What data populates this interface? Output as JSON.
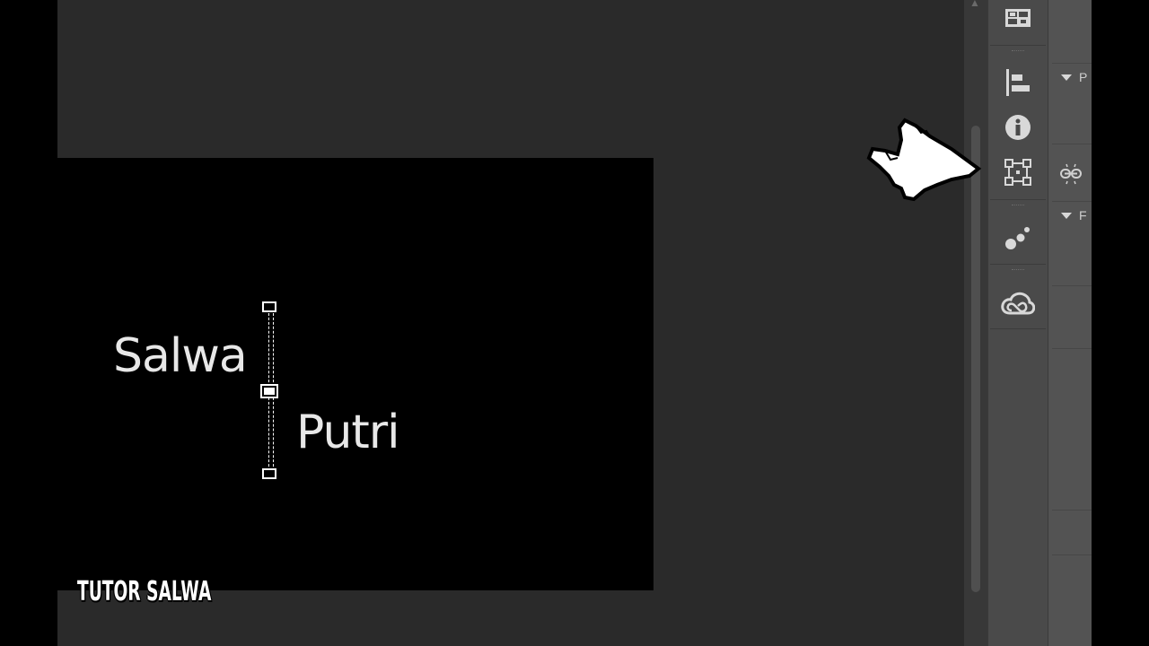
{
  "canvas": {
    "text_line_1": "Salwa",
    "text_line_2": "Putri"
  },
  "toolbar": {
    "items": [
      {
        "name": "libraries-icon"
      },
      {
        "name": "align-icon"
      },
      {
        "name": "info-icon"
      },
      {
        "name": "transform-icon"
      },
      {
        "name": "cc-libraries-dots-icon"
      },
      {
        "name": "creative-cloud-icon"
      }
    ]
  },
  "panel": {
    "section_1_label": "P",
    "section_2_label": "F"
  },
  "watermark": "TUTOR SALWA",
  "colors": {
    "workspace": "#2a2a2a",
    "canvas": "#000000",
    "toolbar": "#4a4a4a",
    "panel": "#535353"
  }
}
